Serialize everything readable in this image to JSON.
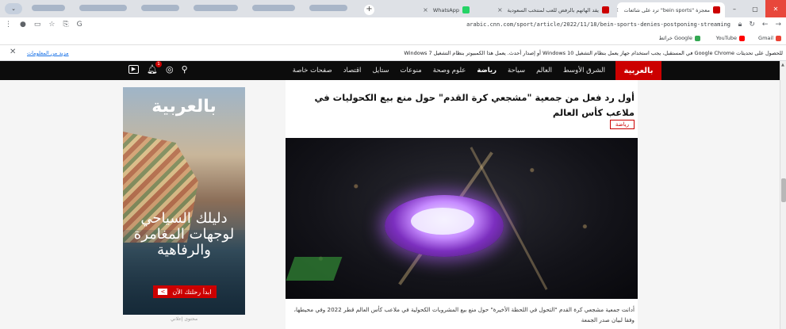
{
  "browser": {
    "tabs": [
      {
        "title": "معجزة \"bein sports\" ترد على شائعات",
        "fav_color": "#cc0000",
        "active": true
      },
      {
        "title": "يقد الهاتهم بالرفض للعب لمنتخب السعودية",
        "fav_color": "#cc0000",
        "active": false
      },
      {
        "title": "WhatsApp",
        "fav_color": "#25d366",
        "active": false
      }
    ],
    "new_tab": "+",
    "url": "arabic.cnn.com/sport/article/2022/11/18/bein-sports-denies-postponing-streaming",
    "bookmarks": [
      {
        "label": "Gmail",
        "color": "#ea4335"
      },
      {
        "label": "YouTube",
        "color": "#ff0000"
      },
      {
        "label": "خرائط Google",
        "color": "#34a853"
      }
    ]
  },
  "infobar": {
    "message": "للحصول على تحديثات Google Chrome في المستقبل، يجب استخدام جهاز يعمل بنظام التشغيل Windows 10 أو إصدار أحدث. يعمل هذا الكمبيوتر بنظام التشغيل Windows 7",
    "more": "مزيد من المعلومات"
  },
  "nav": {
    "logo": "بالعربية",
    "links": [
      "الشرق الأوسط",
      "العالم",
      "سياحة",
      "رياضة",
      "علوم وصحة",
      "منوعات",
      "ستايل",
      "اقتصاد",
      "صفحات خاصة"
    ],
    "active_link": "رياضة",
    "notification_count": "1"
  },
  "article": {
    "headline": "أول رد فعل من جمعية \"مشجعي كرة القدم\" حول منع بيع الكحوليات في ملاعب كأس العالم",
    "tag": "رياضة",
    "caption": "أدانت جمعية مشجعي كرة القدم \"التحول في اللحظة الأخيرة\" حول منع بيع المشروبات الكحولية في ملاعب كأس العالم قطر 2022 وفي محيطها، وفقا لبيان صدر الجمعة"
  },
  "ad": {
    "brand": "بالعربية",
    "headline": "دليلك السياحي لوجهات المغامرة والرفاهية",
    "cta": "ابدأ رحلتك الآن",
    "cta_arrow": ">",
    "label": "محتوى إعلاني"
  },
  "colors": {
    "cnn_red": "#cc0000",
    "nav_bg": "#0c0c0c",
    "stadium_glow": "#c68bff"
  },
  "icons": [
    "video-icon",
    "bell-icon",
    "account-icon",
    "search-icon",
    "star-icon",
    "back-icon",
    "forward-icon",
    "reload-icon",
    "lock-icon"
  ]
}
